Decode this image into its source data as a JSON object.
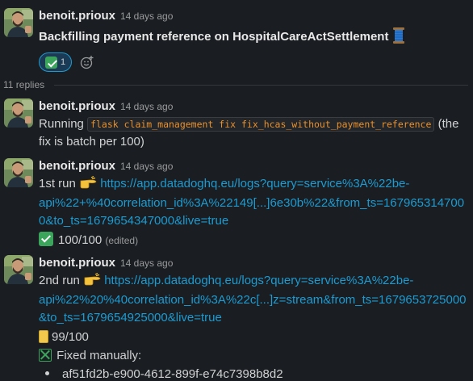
{
  "messages": [
    {
      "author": "benoit.prioux",
      "time": "14 days ago",
      "text": "Backfilling payment reference on HospitalCareActSettlement",
      "reaction_count": "1"
    },
    {
      "author": "benoit.prioux",
      "time": "14 days ago",
      "text_before": "Running",
      "code": "flask claim_management fix fix_hcas_without_payment_reference",
      "text_after": "(the",
      "text_line2": "fix is batch per 100)"
    },
    {
      "author": "benoit.prioux",
      "time": "14 days ago",
      "run_label": "1st run",
      "link_line1": "https://app.datadoghq.eu/logs?query=service%3A%22be-",
      "link_line2": "api%22+%40correlation_id%3A%22149[...]6e30b%22&from_ts=167965314700",
      "link_line3": "0&to_ts=1679654347000&live=true",
      "status": "100/100",
      "edited": "(edited)"
    },
    {
      "author": "benoit.prioux",
      "time": "14 days ago",
      "run_label": "2nd run",
      "link_line1": "https://app.datadoghq.eu/logs?query=service%3A%22be-",
      "link_line2": "api%22%20%40correlation_id%3A%22c[...]z=stream&from_ts=1679653725000",
      "link_line3": "&to_ts=1679654925000&live=true",
      "status": "99/100",
      "fixed_label": "Fixed manually:",
      "bullet_item": "af51fd2b-e900-4612-899f-e74c7398b8d2"
    }
  ],
  "thread": {
    "replies_label": "11 replies"
  },
  "colors": {
    "background": "#1a1d21",
    "link": "#1d9bd1",
    "code": "#e8912d",
    "reaction_border": "#1d9bd1"
  }
}
